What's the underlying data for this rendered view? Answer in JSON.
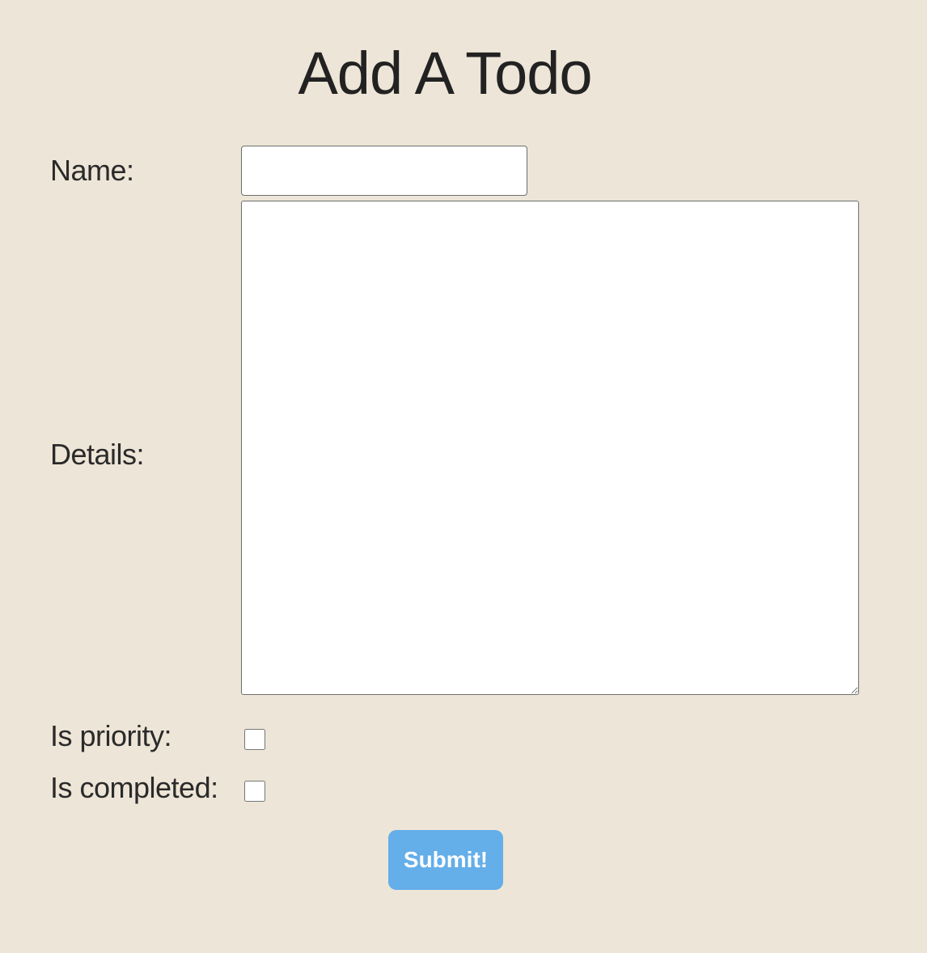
{
  "page": {
    "title": "Add A Todo"
  },
  "form": {
    "name": {
      "label": "Name:",
      "value": "",
      "placeholder": ""
    },
    "details": {
      "label": "Details:",
      "value": "",
      "placeholder": ""
    },
    "is_priority": {
      "label": "Is priority:",
      "checked": false
    },
    "is_completed": {
      "label": "Is completed:",
      "checked": false
    },
    "submit_label": "Submit!"
  },
  "colors": {
    "background": "#ede5d7",
    "submit_button": "#64aee9",
    "submit_text": "#ffffff",
    "text": "#2a2a2a"
  }
}
